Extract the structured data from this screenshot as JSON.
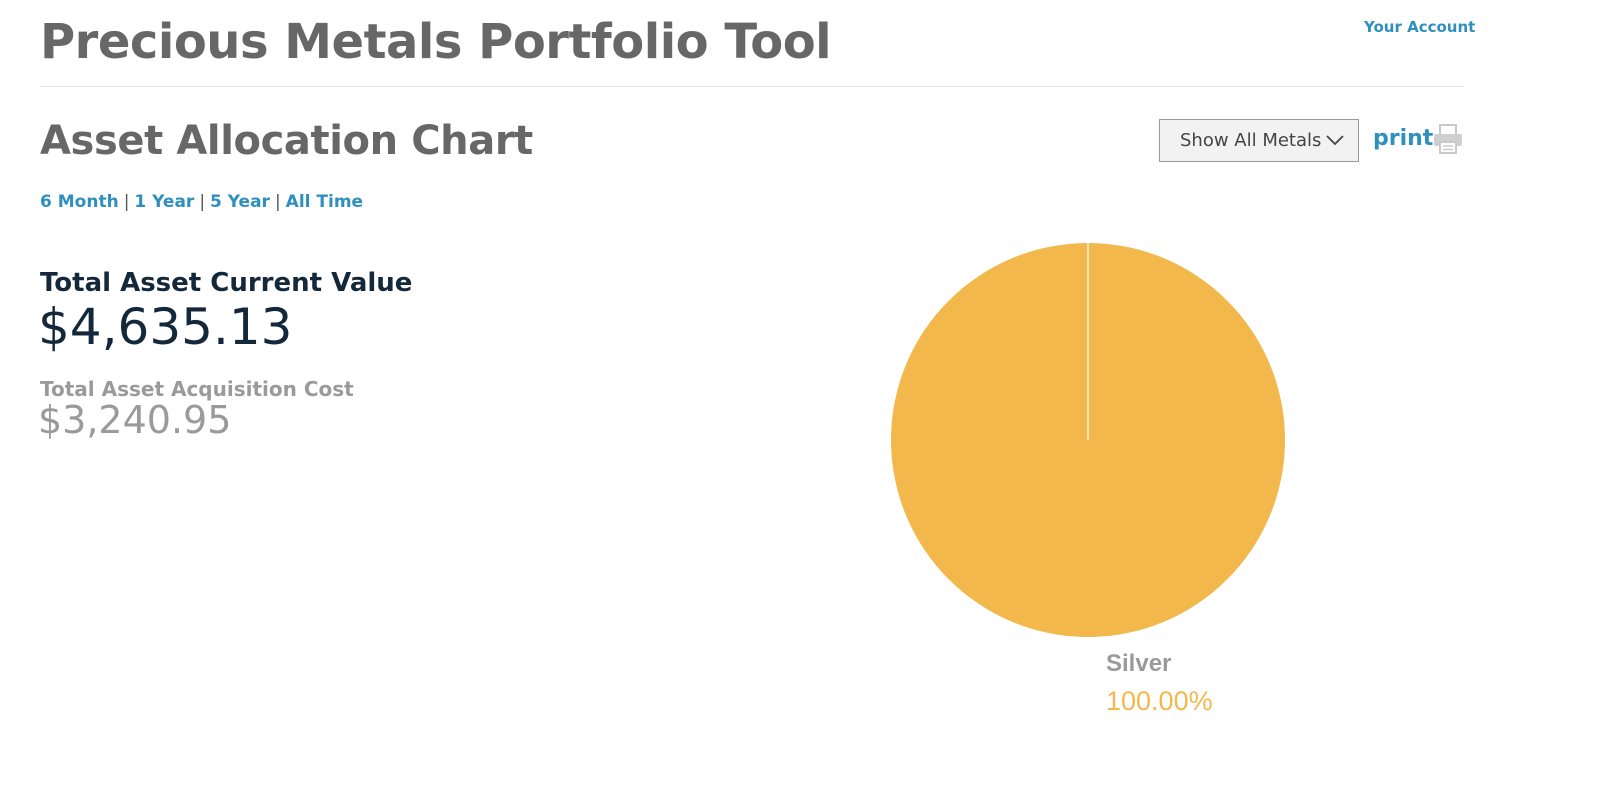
{
  "header": {
    "title": "Precious Metals Portfolio Tool",
    "account_link": "Your Account"
  },
  "section": {
    "title": "Asset Allocation Chart"
  },
  "filter": {
    "selected": "Show All Metals",
    "print_label": "print"
  },
  "icons": {
    "dropdown": "chevron-down-icon",
    "print": "printer-icon"
  },
  "ranges": [
    "6 Month",
    "1 Year",
    "5 Year",
    "All Time"
  ],
  "range_separator": "|",
  "summary": {
    "current_value_label": "Total Asset Current Value",
    "current_value": "$4,635.13",
    "acquisition_cost_label": "Total Asset Acquisition Cost",
    "acquisition_cost": "$3,240.95"
  },
  "colors": {
    "accent": "#2f8fbe",
    "silver_slice": "#f2b84b",
    "title": "#676767",
    "value": "#13283a",
    "muted": "#9a9a9a"
  },
  "chart_data": {
    "type": "pie",
    "slices": [
      {
        "label": "Silver",
        "value": 100.0,
        "percent_label": "100.00%",
        "color": "#f2b84b"
      }
    ]
  }
}
